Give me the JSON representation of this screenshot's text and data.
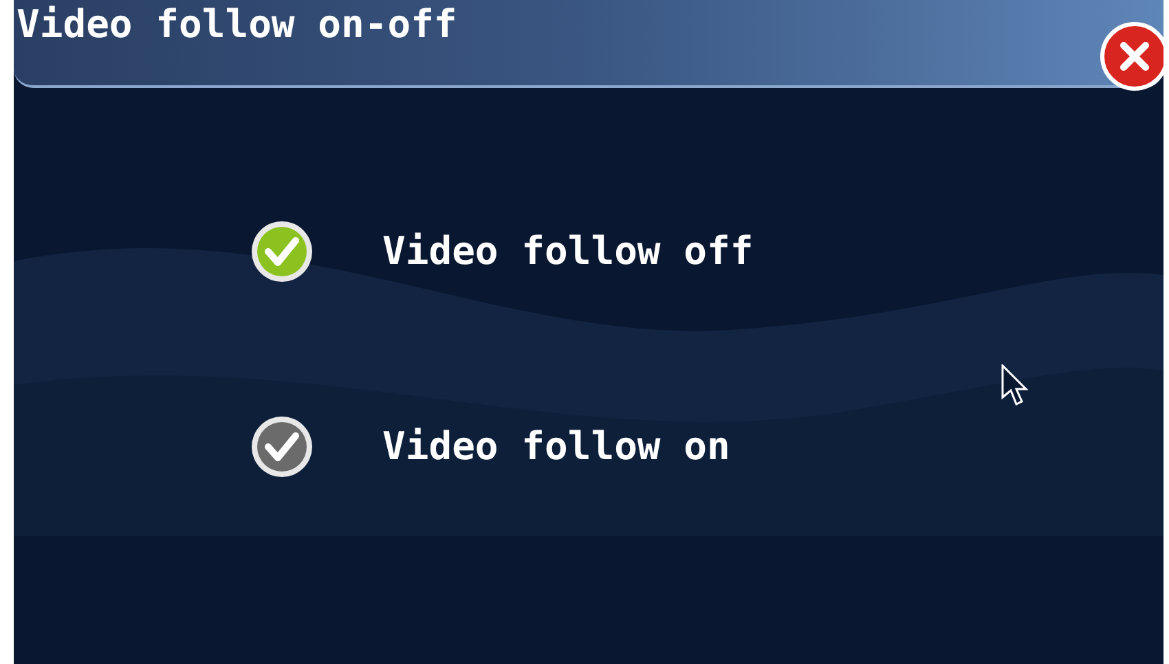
{
  "window": {
    "title": "Video follow on-off"
  },
  "options": [
    {
      "label": "Video follow off",
      "selected": true
    },
    {
      "label": "Video follow on",
      "selected": false
    }
  ]
}
